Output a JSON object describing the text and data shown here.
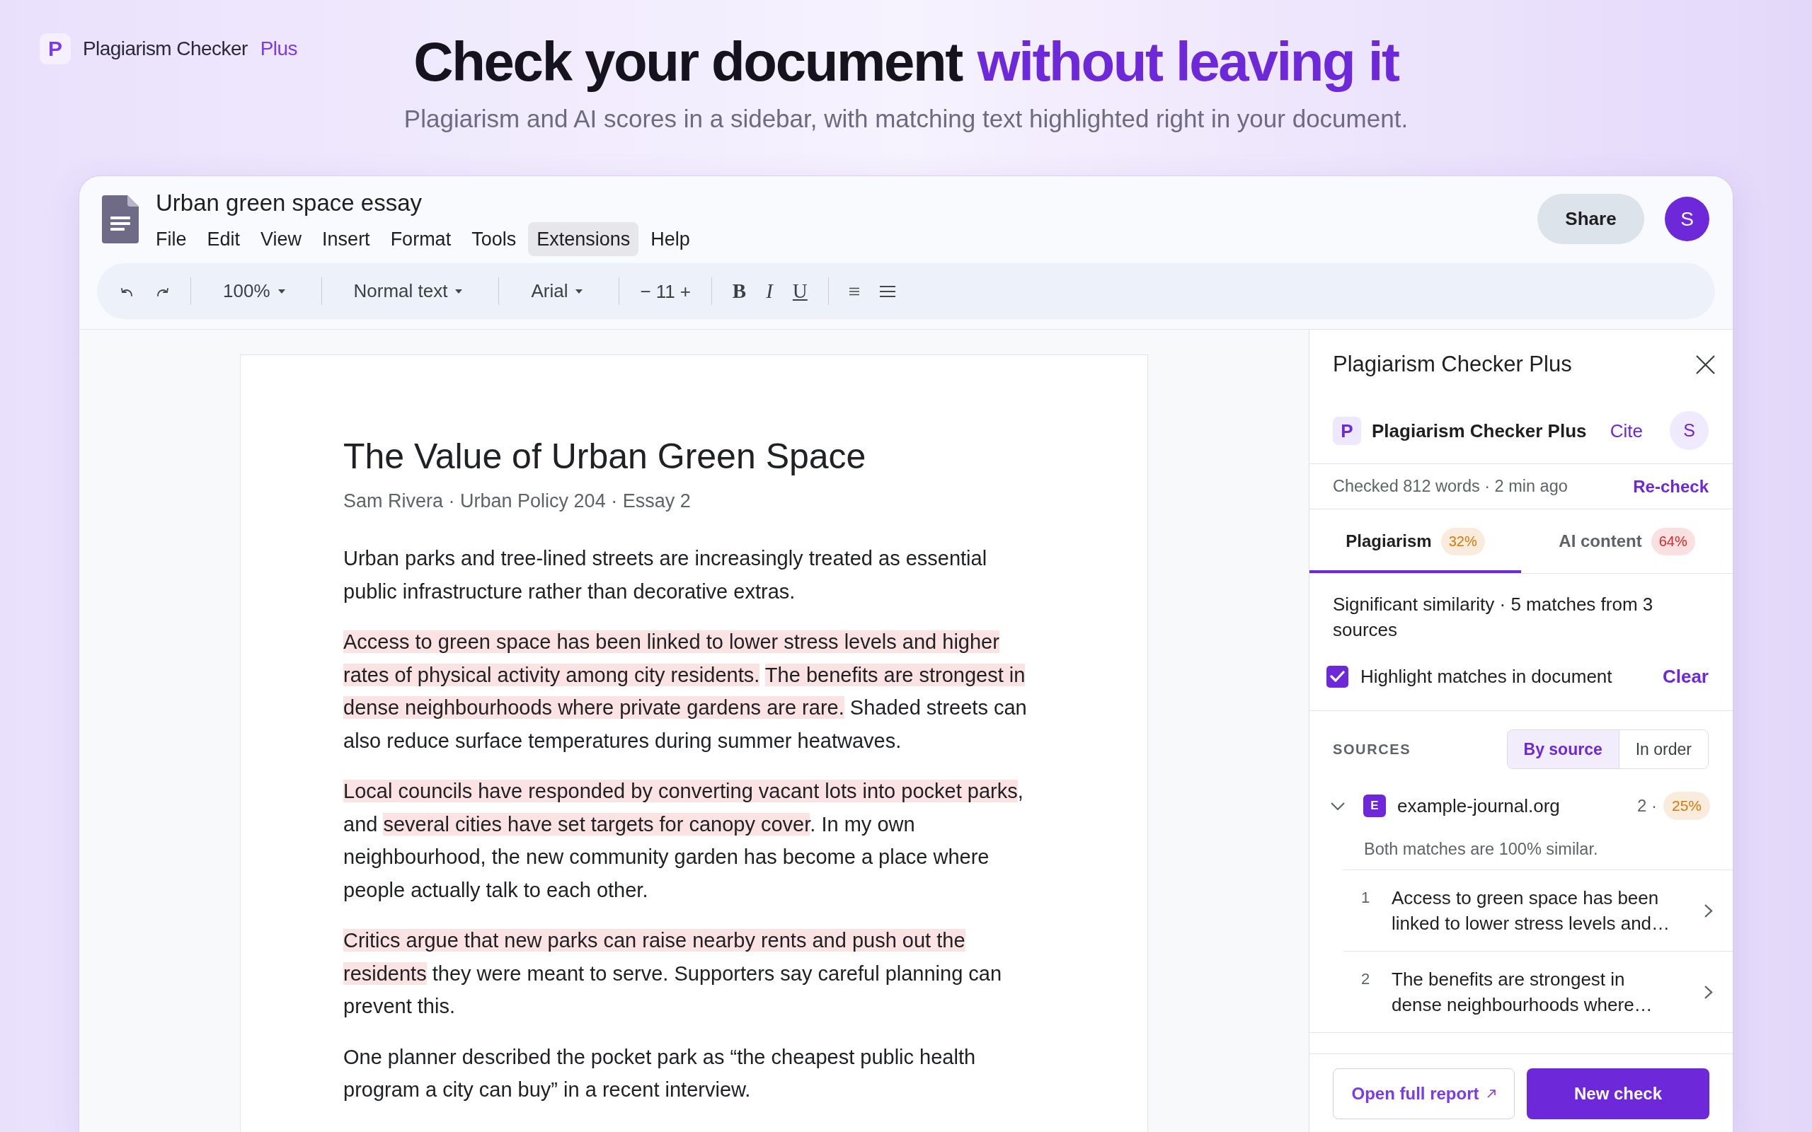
{
  "brand": {
    "logo_letter": "P",
    "name": "Plagiarism Checker",
    "tier": "Plus"
  },
  "hero": {
    "title": [
      {
        "text": "Check your document",
        "accent": false
      },
      {
        "text": "without leaving it",
        "accent": true
      }
    ],
    "subtitle": "Plagiarism and AI scores in a sidebar, with matching text highlighted right in your document."
  },
  "doc_window": {
    "title": "Urban green space essay",
    "menu": [
      {
        "label": "File",
        "selected": false
      },
      {
        "label": "Edit",
        "selected": false
      },
      {
        "label": "View",
        "selected": false
      },
      {
        "label": "Insert",
        "selected": false
      },
      {
        "label": "Format",
        "selected": false
      },
      {
        "label": "Tools",
        "selected": false
      },
      {
        "label": "Extensions",
        "selected": true
      },
      {
        "label": "Help",
        "selected": false
      }
    ],
    "share": "Share",
    "avatar": "S",
    "toolbar": {
      "zoom": "100%",
      "style": "Normal text",
      "font": "Arial",
      "font_size": {
        "decrease": "−",
        "value": "11",
        "increase": "+"
      },
      "format": [
        {
          "label": "B",
          "kind": "bold"
        },
        {
          "label": "I",
          "kind": "italic"
        },
        {
          "label": "U",
          "kind": "underline"
        }
      ]
    },
    "document": {
      "title": "The Value of Urban Green Space",
      "byline": "Sam Rivera · Urban Policy 204 · Essay 2",
      "paragraphs": [
        {
          "text": "Urban parks and tree-lined streets are increasingly treated as essential public infrastructure rather than decorative extras."
        },
        {
          "segments": [
            {
              "text": "Access to green space has been linked to lower stress levels and higher rates of physical activity among city residents.",
              "highlighted": true
            },
            {
              "text": " The benefits are strongest in dense neighbourhoods where private gardens are rare.",
              "highlighted": true
            },
            {
              "text": " Shaded streets can also reduce surface temperatures during summer heatwaves.",
              "highlighted": false
            }
          ]
        },
        {
          "segments": [
            {
              "text": "Local councils have responded by converting vacant lots into pocket parks",
              "highlighted": true
            },
            {
              "text": ", and ",
              "highlighted": false
            },
            {
              "text": "several cities have set targets for canopy cover",
              "highlighted": true
            },
            {
              "text": ". In my own neighbourhood, the new community garden has become a place where people actually talk to each other.",
              "highlighted": false
            }
          ]
        },
        {
          "segments": [
            {
              "text": "Critics argue that new parks can raise nearby rents and push out the residents",
              "highlighted": true
            },
            {
              "text": " they were meant to serve. Supporters say careful planning can prevent this.",
              "highlighted": false
            }
          ]
        },
        {
          "text": "One planner described the pocket park as “the cheapest public health program a city can buy” in a recent interview."
        }
      ]
    }
  },
  "sidebar": {
    "title": "Plagiarism Checker Plus",
    "brand": {
      "logo_letter": "P",
      "name": "Plagiarism Checker Plus",
      "cite": "Cite",
      "avatar": "S"
    },
    "status": {
      "text": "Checked 812 words · 2 min ago",
      "action": "Re-check"
    },
    "tabs": [
      {
        "label": "Plagiarism",
        "score": "32%",
        "color": "#d97706",
        "selected": true
      },
      {
        "label": "AI content",
        "score": "64%",
        "color": "#dc2626",
        "selected": false
      }
    ],
    "summary": "Significant similarity · 5 matches from 3 sources",
    "highlight_toggle": {
      "label": "Highlight matches in document",
      "checked": true,
      "action": "Clear"
    },
    "sources": {
      "heading": "SOURCES",
      "views": [
        {
          "label": "By source",
          "selected": true
        },
        {
          "label": "In order",
          "selected": false
        }
      ],
      "items": [
        {
          "favicon_letter": "E",
          "domain": "example-journal.org",
          "count": "2 ·",
          "score": "25%",
          "color": "#d97706",
          "expanded": true,
          "note": "Both matches are 100% similar.",
          "matches": [
            {
              "number": "1",
              "text": "Access to green space has been linked to lower stress levels and…"
            },
            {
              "number": "2",
              "text": "The benefits are strongest in dense neighbourhoods where…"
            }
          ]
        }
      ]
    },
    "footer": {
      "secondary": "Open full report",
      "primary": "New check"
    }
  }
}
